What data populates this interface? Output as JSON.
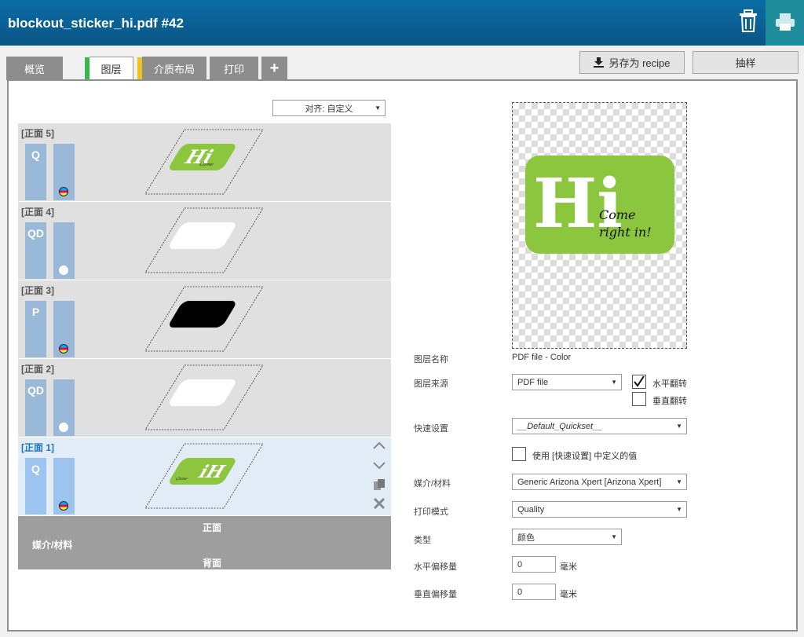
{
  "header": {
    "title": "blockout_sticker_hi.pdf #42"
  },
  "icons": {
    "trash": "trash-icon",
    "print": "printer-icon",
    "download": "download-icon",
    "plus": "plus-icon"
  },
  "colors": {
    "header": "#0a5f95",
    "print_button": "#1e8e9c",
    "layers_tab_marker": "#3cb54a",
    "media_tab_marker": "#f2c21b",
    "selected_row": "#e1ecf7",
    "logo_green": "#8cc63f"
  },
  "tabs": {
    "overview": "概览",
    "layers": "图层",
    "media_layout": "介质布局",
    "print": "打印",
    "add": "+"
  },
  "toolbar": {
    "save_recipe": "另存为 recipe",
    "sample": "抽样"
  },
  "align": {
    "value": "对齐: 自定义"
  },
  "layers": [
    {
      "label": "[正面 5]",
      "mode": "Q",
      "ink": "cmyk",
      "art": "logo"
    },
    {
      "label": "[正面 4]",
      "mode": "QD",
      "ink": "white",
      "art": "white"
    },
    {
      "label": "[正面 3]",
      "mode": "P",
      "ink": "cmyk",
      "art": "black"
    },
    {
      "label": "[正面 2]",
      "mode": "QD",
      "ink": "white",
      "art": "white"
    },
    {
      "label": "[正面 1]",
      "mode": "Q",
      "ink": "cmyk",
      "art": "logo-flipped",
      "selected": true
    }
  ],
  "layer_summary": {
    "front": "正面",
    "media": "媒介/材料",
    "back": "背面"
  },
  "preview": {
    "logo_big": "Hi",
    "logo_script_1": "Come",
    "logo_script_2": "right in!"
  },
  "props": {
    "layer_name_label": "图层名称",
    "layer_name_value": "PDF file - Color",
    "layer_source_label": "图层来源",
    "layer_source_value": "PDF file",
    "flip_h_label": "水平翻转",
    "flip_h_checked": true,
    "flip_v_label": "垂直翻转",
    "flip_v_checked": false,
    "quickset_label": "快速设置",
    "quickset_value": "__Default_Quickset__",
    "use_quickset_label": "使用 [快速设置] 中定义的值",
    "use_quickset_checked": false,
    "media_label": "媒介/材料",
    "media_value": "Generic Arizona Xpert [Arizona Xpert]",
    "print_mode_label": "打印模式",
    "print_mode_value": "Quality",
    "type_label": "类型",
    "type_value": "颜色",
    "h_offset_label": "水平偏移量",
    "h_offset_value": "0",
    "v_offset_label": "垂直偏移量",
    "v_offset_value": "0",
    "unit": "毫米"
  }
}
